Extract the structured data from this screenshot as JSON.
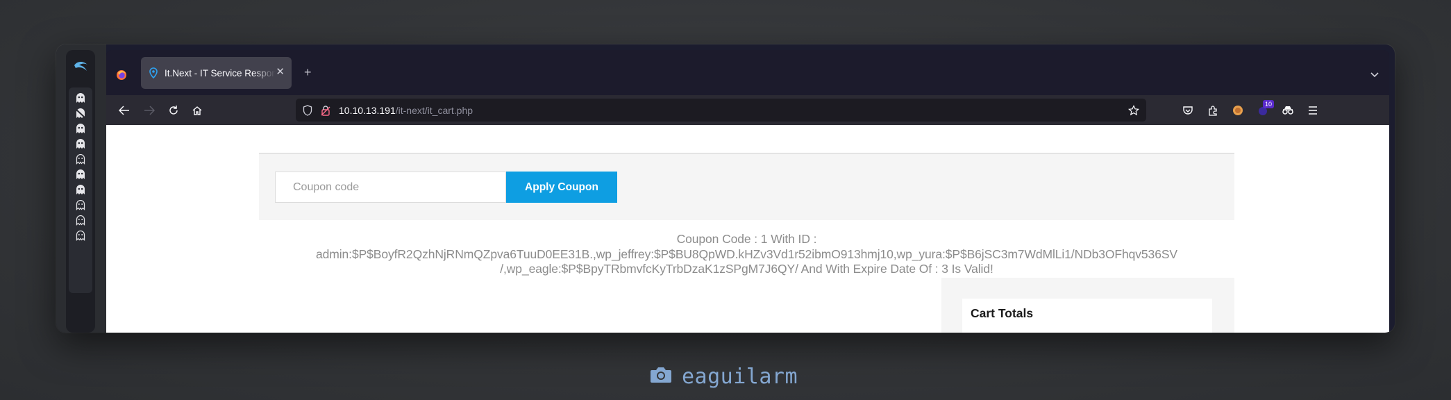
{
  "browser": {
    "tab": {
      "title": "It.Next - IT Service Responsive"
    },
    "address": {
      "host": "10.10.13.191",
      "path": "/it-next/it_cart.php"
    },
    "toolbar": {
      "extension_badge": "10"
    }
  },
  "dock": {
    "icons": [
      "kali-dragon-icon",
      "ghost-icon",
      "ghost-slashed-icon",
      "ghost-icon",
      "ghost-icon",
      "ghost-outline-icon",
      "ghost-icon",
      "ghost-icon",
      "ghost-outline-icon",
      "ghost-outline-icon",
      "ghost-outline-icon"
    ]
  },
  "page": {
    "coupon": {
      "placeholder": "Coupon code",
      "button": "Apply Coupon"
    },
    "notice": {
      "line1": "Coupon Code : 1 With ID :",
      "line2": "admin:$P$BoyfR2QzhNjRNmQZpva6TuuD0EE31B.,wp_jeffrey:$P$BU8QpWD.kHZv3Vd1r52ibmO913hmj10,wp_yura:$P$B6jSC3m7WdMlLi1/NDb3OFhqv536SV",
      "line3": "/,wp_eagle:$P$BpyTRbmvfcKyTrbDzaK1zSPgM7J6QY/ And With Expire Date Of : 3 Is Valid!"
    },
    "cart_totals": {
      "title": "Cart Totals"
    }
  },
  "signature": {
    "text": "eaguilarm"
  },
  "colors": {
    "accent_button": "#0e9ee2",
    "signature": "#84a7d1",
    "browser_chrome": "#1c1b2c"
  }
}
